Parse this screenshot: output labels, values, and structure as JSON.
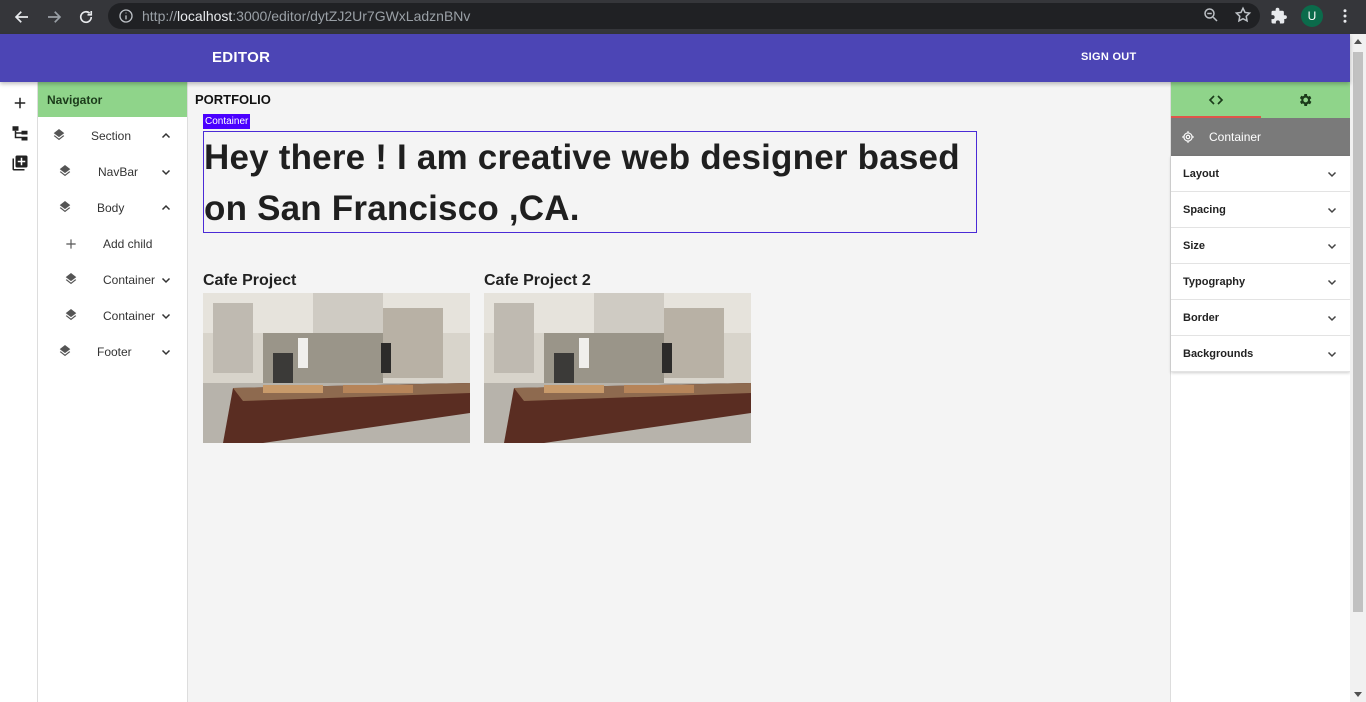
{
  "browser": {
    "url_host": "localhost",
    "url_prefix": "http://",
    "url_rest": ":3000/editor/dytZJ2Ur7GWxLadznBNv",
    "avatar_letter": "U"
  },
  "appbar": {
    "title": "EDITOR",
    "signout_label": "SIGN OUT",
    "color": "#4c45b5"
  },
  "navigator": {
    "header": "Navigator",
    "items": [
      {
        "label": "Section",
        "icon": "layers-icon",
        "expanded": true
      },
      {
        "label": "NavBar",
        "icon": "layers-icon",
        "expanded": false
      },
      {
        "label": "Body",
        "icon": "layers-icon",
        "expanded": true
      },
      {
        "label": "Add child",
        "icon": "plus-icon"
      },
      {
        "label": "Container",
        "icon": "layers-icon",
        "expanded": false
      },
      {
        "label": "Container",
        "icon": "layers-icon",
        "expanded": false
      },
      {
        "label": "Footer",
        "icon": "layers-icon",
        "expanded": false
      }
    ]
  },
  "canvas": {
    "heading": "PORTFOLIO",
    "selected_tag": "Container",
    "hero_text": "Hey there ! I am creative web designer based on San Francisco ,CA.",
    "projects": [
      {
        "title": "Cafe Project"
      },
      {
        "title": "Cafe Project 2"
      }
    ]
  },
  "right_panel": {
    "selected_component": "Container",
    "sections": [
      "Layout",
      "Spacing",
      "Size",
      "Typography",
      "Border",
      "Backgrounds"
    ]
  }
}
